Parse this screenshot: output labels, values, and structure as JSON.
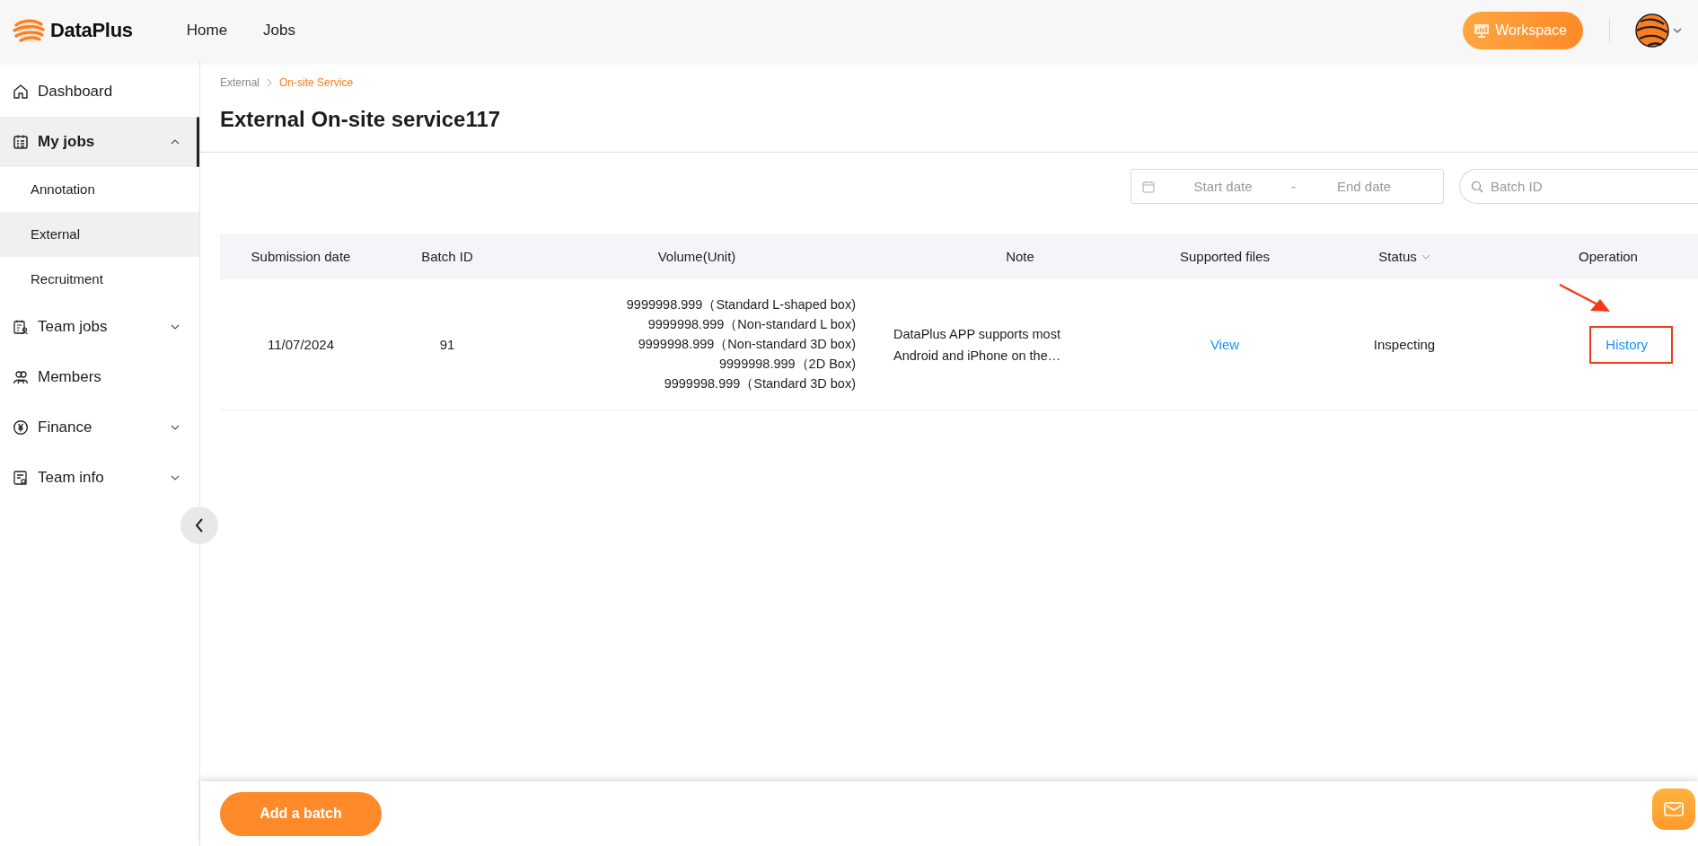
{
  "header": {
    "brand": "DataPlus",
    "nav": [
      "Home",
      "Jobs"
    ],
    "workspace_button": "Workspace"
  },
  "sidebar": {
    "items": [
      {
        "label": "Dashboard",
        "selected": false
      },
      {
        "label": "My jobs",
        "selected": true,
        "expanded": true,
        "children": [
          {
            "label": "Annotation",
            "selected": false
          },
          {
            "label": "External",
            "selected": true
          },
          {
            "label": "Recruitment",
            "selected": false
          }
        ]
      },
      {
        "label": "Team jobs",
        "selected": false,
        "expanded": false
      },
      {
        "label": "Members",
        "selected": false
      },
      {
        "label": "Finance",
        "selected": false,
        "expanded": false
      },
      {
        "label": "Team info",
        "selected": false,
        "expanded": false
      }
    ]
  },
  "breadcrumb": [
    {
      "label": "External",
      "selected": false
    },
    {
      "label": "On-site Service",
      "selected": true
    }
  ],
  "page_title": "External On-site service117",
  "filters": {
    "start_placeholder": "Start date",
    "separator": "-",
    "end_placeholder": "End date",
    "search_placeholder": "Batch ID"
  },
  "table": {
    "columns": [
      {
        "label": "Submission date",
        "sortable": false
      },
      {
        "label": "Batch ID",
        "sortable": false
      },
      {
        "label": "Volume(Unit)",
        "sortable": false
      },
      {
        "label": "Note",
        "sortable": false
      },
      {
        "label": "Supported files",
        "sortable": false
      },
      {
        "label": "Status",
        "sortable": true
      },
      {
        "label": "Operation",
        "sortable": false
      }
    ],
    "rows": [
      {
        "submission_date": "11/07/2024",
        "batch_id": "91",
        "volume": [
          "9999998.999（Standard L-shaped box)",
          "9999998.999（Non-standard L box)",
          "9999998.999（Non-standard 3D box)",
          "9999998.999（2D Box)",
          "9999998.999（Standard 3D box)"
        ],
        "note": "DataPlus APP supports most Android and iPhone on the…",
        "supported_files": "View",
        "status": "Inspecting",
        "operation": "History",
        "highlighted": true
      }
    ]
  },
  "footer": {
    "add_button": "Add a batch"
  }
}
